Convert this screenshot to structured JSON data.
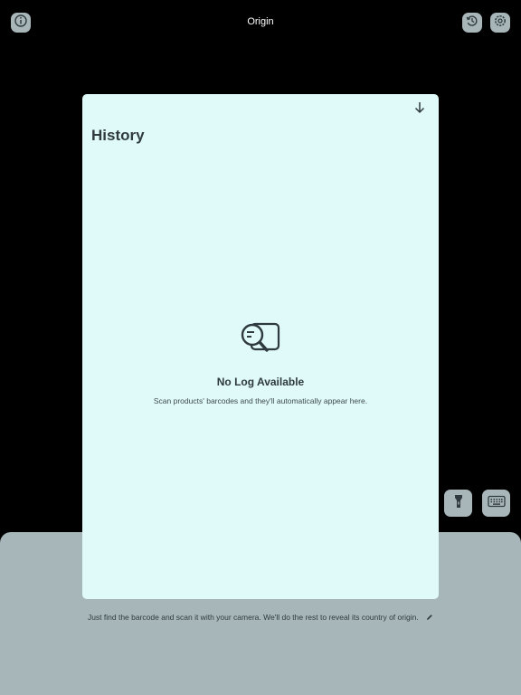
{
  "app": {
    "title": "Origin"
  },
  "icons": {
    "info": "info-circle-icon",
    "history": "history-clock-icon",
    "settings": "gear-icon",
    "flashlight": "flashlight-icon",
    "keyboard": "keyboard-icon",
    "close": "arrow-down-icon",
    "empty": "search-document-icon",
    "edit": "pencil-icon"
  },
  "colors": {
    "background": "#000000",
    "modal": "#e0fafa",
    "panel": "#a7b6b8",
    "button": "#a9b6b9",
    "text": "#2f3a40"
  },
  "bottom_panel": {
    "description": "Just find the barcode and scan it with your camera. We'll do the rest to reveal its country of origin."
  },
  "modal": {
    "title": "History",
    "empty_title": "No Log Available",
    "empty_subtitle": "Scan products' barcodes and they'll automatically appear here."
  }
}
